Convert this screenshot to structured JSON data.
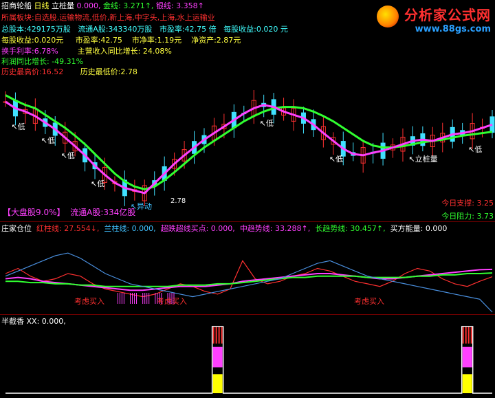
{
  "window": {
    "security_name": "招商轮船",
    "period": "日线"
  },
  "main_indicator": {
    "name": "立桩量",
    "value": "0.000,",
    "gold_line": "金线: 3.271↑,",
    "silver_line": "银线: 3.358↑"
  },
  "info": {
    "sectors": "所属板块:自选股,运输物流,低价,新上海,中字头,上海,水上运输业",
    "total_shares": "总股本:429175万股",
    "float_a_shares": "流通A股:343340万股",
    "pe_ratio": "市盈率:42.75 倍",
    "eps": "每股收益:0.020 元",
    "eps2": "每股收益:0.020元",
    "pe2": "市盈率:42.75",
    "pb": "市净率:1.19元",
    "net_assets": "净资产:2.87元",
    "turnover": "换手利率:6.78%",
    "main_income_growth": "主营收入同比增长: 24.08%",
    "profit_growth": "利润同比增长: -49.31%",
    "hist_high": "历史最高价:16.52",
    "hist_low": "历史最低价:2.78"
  },
  "main_overlay": {
    "market_cap_type": "【大盘股9.0%】",
    "float_label": "流通A股:334亿股",
    "today_support": "今日支撑: 3.25",
    "today_resistance": "今日阻力: 3.73",
    "low_price_label": "2.78"
  },
  "annotations": [
    {
      "text": "低",
      "color": "#ffffff"
    },
    {
      "text": "低",
      "color": "#ffffff"
    },
    {
      "text": "低",
      "color": "#ffffff"
    },
    {
      "text": "异动",
      "color": "#40c0ff"
    },
    {
      "text": "低",
      "color": "#ffffff"
    },
    {
      "text": "低",
      "color": "#ffffff"
    },
    {
      "text": "低",
      "color": "#ffffff"
    },
    {
      "text": "立桩量",
      "color": "#ffffff"
    },
    {
      "text": "低",
      "color": "#ffffff"
    }
  ],
  "panel2": {
    "name": "庄家仓位",
    "red_line": "红柱线: 27.554↓,",
    "blue_line": "兰柱线: 0.000,",
    "bottom_buy": "超跌超线买点: 0.000,",
    "mid_trend": "中趋势线: 33.288↑,",
    "long_trend": "长趋势线: 30.457↑,",
    "buy_power": "买方能量: 0.000",
    "note1": "考虑买入",
    "note2": "考虑买入",
    "note3": "考虑买入"
  },
  "panel3": {
    "name": "半截香",
    "value": "XX: 0.000,"
  },
  "watermark": {
    "title": "分析家公式网",
    "url": "www.88gs.com"
  },
  "colors": {
    "background": "#000000",
    "panel_border": "#6e0000",
    "up_candle": "#ff3030",
    "down_candle": "#40e0ff",
    "green_line": "#30ff30",
    "magenta_line": "#ff40ff",
    "yellow_bar": "#ffff00",
    "red_text": "#ff3030",
    "cyan_text": "#40ffff",
    "yellow_text": "#ffff40"
  },
  "chart_data": [
    {
      "type": "line",
      "panel": "main",
      "x": [
        1,
        2,
        3,
        4,
        5,
        6,
        7,
        8,
        9,
        10,
        11,
        12,
        13,
        14,
        15,
        16,
        17,
        18,
        19,
        20,
        21,
        22,
        23,
        24,
        25,
        26,
        27,
        28,
        29,
        30,
        31,
        32,
        33,
        34,
        35,
        36,
        37,
        38,
        39,
        40,
        41,
        42,
        43,
        44,
        45,
        46,
        47,
        48,
        49,
        50
      ],
      "series": [
        {
          "name": "金线",
          "values": [
            4.3,
            4.22,
            4.15,
            4.1,
            4.0,
            3.9,
            3.8,
            3.68,
            3.55,
            3.4,
            3.25,
            3.1,
            2.98,
            2.9,
            2.86,
            2.9,
            3.0,
            3.12,
            3.25,
            3.38,
            3.5,
            3.6,
            3.7,
            3.8,
            3.9,
            3.98,
            4.05,
            4.1,
            4.12,
            4.12,
            4.1,
            4.05,
            3.98,
            3.9,
            3.8,
            3.7,
            3.6,
            3.53,
            3.5,
            3.5,
            3.52,
            3.55,
            3.58,
            3.6,
            3.62,
            3.65,
            3.68,
            3.7,
            3.72,
            3.74
          ]
        },
        {
          "name": "银线",
          "values": [
            4.2,
            4.1,
            4.05,
            3.98,
            3.88,
            3.78,
            3.65,
            3.52,
            3.38,
            3.22,
            3.08,
            2.96,
            2.88,
            2.84,
            2.8,
            2.95,
            3.1,
            3.25,
            3.38,
            3.5,
            3.62,
            3.72,
            3.82,
            3.92,
            4.02,
            4.1,
            4.15,
            4.12,
            4.05,
            4.0,
            3.95,
            3.85,
            3.72,
            3.6,
            3.48,
            3.4,
            3.38,
            3.42,
            3.45,
            3.5,
            3.55,
            3.6,
            3.62,
            3.6,
            3.65,
            3.7,
            3.72,
            3.75,
            3.8,
            3.85
          ]
        }
      ],
      "ylim": [
        2.6,
        4.6
      ]
    },
    {
      "type": "line",
      "panel": "庄家仓位",
      "x": [
        1,
        2,
        3,
        4,
        5,
        6,
        7,
        8,
        9,
        10,
        11,
        12,
        13,
        14,
        15,
        16,
        17,
        18,
        19,
        20,
        21,
        22,
        23,
        24,
        25,
        26,
        27,
        28,
        29,
        30,
        31,
        32,
        33,
        34,
        35,
        36,
        37,
        38,
        39,
        40
      ],
      "series": [
        {
          "name": "红柱线",
          "values": [
            30,
            34,
            28,
            24,
            26,
            30,
            28,
            22,
            18,
            16,
            14,
            12,
            14,
            18,
            22,
            20,
            16,
            14,
            18,
            40,
            26,
            22,
            24,
            28,
            30,
            34,
            32,
            28,
            24,
            22,
            20,
            24,
            30,
            34,
            32,
            26,
            22,
            20,
            24,
            27.554
          ]
        },
        {
          "name": "中趋势线",
          "values": [
            26,
            27,
            26,
            24,
            23,
            22,
            21,
            20,
            19,
            18,
            17,
            17,
            18,
            19,
            20,
            20,
            20,
            21,
            22,
            24,
            25,
            26,
            27,
            28,
            29,
            30,
            30,
            29,
            28,
            27,
            26,
            26,
            27,
            28,
            29,
            30,
            31,
            32,
            33,
            33.288
          ]
        },
        {
          "name": "长趋势线",
          "values": [
            24,
            24,
            23,
            23,
            22,
            22,
            21,
            21,
            20,
            20,
            20,
            20,
            20,
            20,
            21,
            21,
            21,
            22,
            22,
            23,
            24,
            25,
            26,
            27,
            27,
            28,
            28,
            28,
            28,
            27,
            27,
            27,
            27,
            28,
            28,
            29,
            29,
            30,
            30,
            30.457
          ]
        },
        {
          "name": "兰柱线",
          "values": [
            28,
            32,
            36,
            40,
            44,
            46,
            42,
            36,
            30,
            26,
            22,
            20,
            18,
            16,
            14,
            12,
            14,
            16,
            18,
            20,
            22,
            24,
            26,
            30,
            34,
            38,
            40,
            36,
            32,
            28,
            26,
            24,
            22,
            20,
            18,
            16,
            14,
            12,
            10,
            0
          ]
        }
      ],
      "ylim": [
        0,
        60
      ]
    },
    {
      "type": "bar",
      "panel": "半截香",
      "x": [
        1,
        2,
        3,
        4,
        5,
        6,
        7,
        8,
        9,
        10,
        11,
        12,
        13,
        14,
        15,
        16,
        17,
        18,
        19,
        20,
        21,
        22,
        23,
        24,
        25,
        26,
        27,
        28,
        29,
        30,
        31,
        32,
        33,
        34,
        35,
        36,
        37,
        38,
        39,
        40
      ],
      "values": [
        0,
        0,
        0,
        0,
        0,
        0,
        0,
        0,
        0,
        0,
        0,
        0,
        0,
        0,
        0,
        0,
        0,
        1,
        0,
        0,
        0,
        0,
        0,
        0,
        0,
        0,
        0,
        0,
        0,
        0,
        0,
        0,
        0,
        0,
        0,
        0,
        0,
        1,
        0,
        0
      ],
      "ylim": [
        0,
        1
      ]
    }
  ]
}
